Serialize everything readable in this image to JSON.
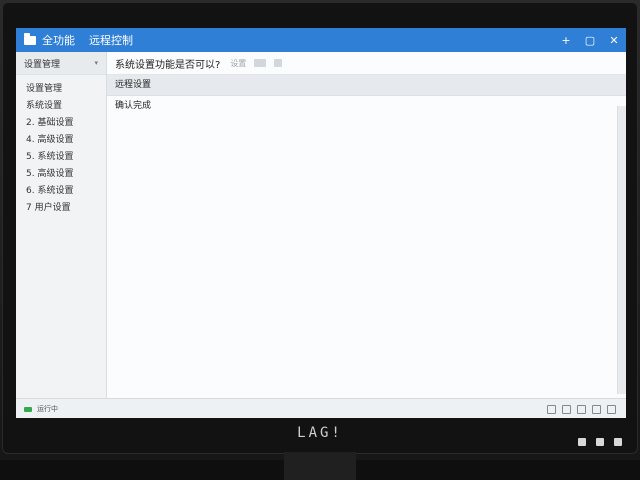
{
  "window": {
    "app_title": "全功能",
    "doc_title": "远程控制",
    "controls": [
      "+",
      "▢",
      "✕"
    ]
  },
  "sidebar": {
    "header": "设置管理",
    "items": [
      "设置管理",
      "系统设置",
      "2. 基础设置",
      "4. 高级设置",
      "5. 系统设置",
      "5. 高级设置",
      "6. 系统设置",
      "7 用户设置"
    ]
  },
  "toolbar": {
    "question": "系统设置功能是否可以?",
    "button": "设置"
  },
  "content": {
    "rows": [
      "远程设置",
      "确认完成"
    ]
  },
  "status": {
    "text": "运行中"
  },
  "monitor": {
    "brand": "LAG!"
  },
  "colors": {
    "titlebar": "#2f7fd6",
    "status_led": "#35a852"
  }
}
